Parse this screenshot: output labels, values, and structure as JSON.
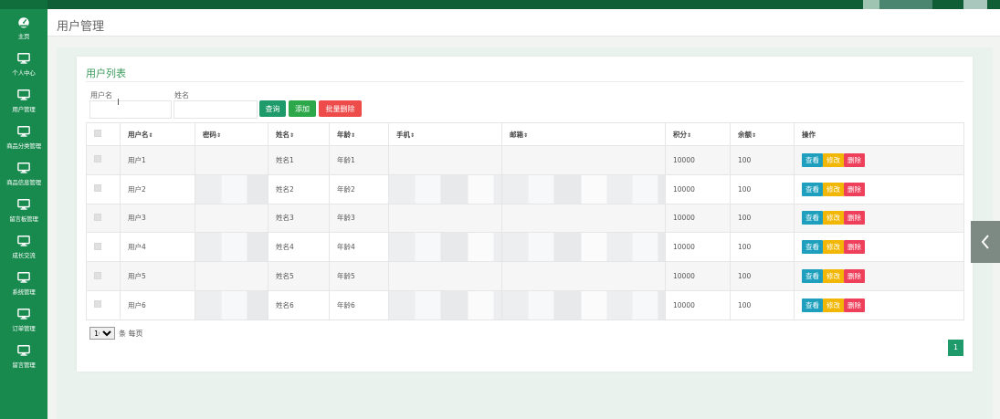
{
  "sidebar": {
    "items": [
      {
        "label": "主页",
        "icon": "dashboard-icon"
      },
      {
        "label": "个人中心",
        "icon": "monitor-icon"
      },
      {
        "label": "用户管理",
        "icon": "monitor-icon"
      },
      {
        "label": "商品分类管理",
        "icon": "monitor-icon"
      },
      {
        "label": "商品信息管理",
        "icon": "monitor-icon"
      },
      {
        "label": "留言板管理",
        "icon": "monitor-icon"
      },
      {
        "label": "成长交流",
        "icon": "monitor-icon"
      },
      {
        "label": "系统管理",
        "icon": "monitor-icon"
      },
      {
        "label": "订单管理",
        "icon": "monitor-icon"
      },
      {
        "label": "留言管理",
        "icon": "monitor-icon"
      }
    ]
  },
  "header": {
    "title": "用户管理"
  },
  "card": {
    "title": "用户列表"
  },
  "filters": {
    "username_label": "用户名",
    "name_label": "姓名",
    "query_button": "查询",
    "add_button": "添加",
    "batch_delete_button": "批量删除"
  },
  "table": {
    "headers": [
      "用户名",
      "密码",
      "姓名",
      "年龄",
      "手机",
      "邮箱",
      "积分",
      "余额",
      "操作"
    ],
    "rows": [
      {
        "username": "用户1",
        "name": "姓名1",
        "age": "年龄1",
        "points": "10000",
        "balance": "100"
      },
      {
        "username": "用户2",
        "name": "姓名2",
        "age": "年龄2",
        "points": "10000",
        "balance": "100"
      },
      {
        "username": "用户3",
        "name": "姓名3",
        "age": "年龄3",
        "points": "10000",
        "balance": "100"
      },
      {
        "username": "用户4",
        "name": "姓名4",
        "age": "年龄4",
        "points": "10000",
        "balance": "100"
      },
      {
        "username": "用户5",
        "name": "姓名5",
        "age": "年龄5",
        "points": "10000",
        "balance": "100"
      },
      {
        "username": "用户6",
        "name": "姓名6",
        "age": "年龄6",
        "points": "10000",
        "balance": "100"
      }
    ],
    "actions": {
      "view": "查看",
      "edit": "修改",
      "delete": "删除"
    }
  },
  "pagination": {
    "page_size": "10",
    "page_size_label": "条 每页",
    "current_page": "1"
  },
  "colors": {
    "sidebar": "#188a4e",
    "accent": "#1f9a6b",
    "danger": "#ee3f5b",
    "warning": "#f2b705",
    "info": "#1e9fbd"
  }
}
